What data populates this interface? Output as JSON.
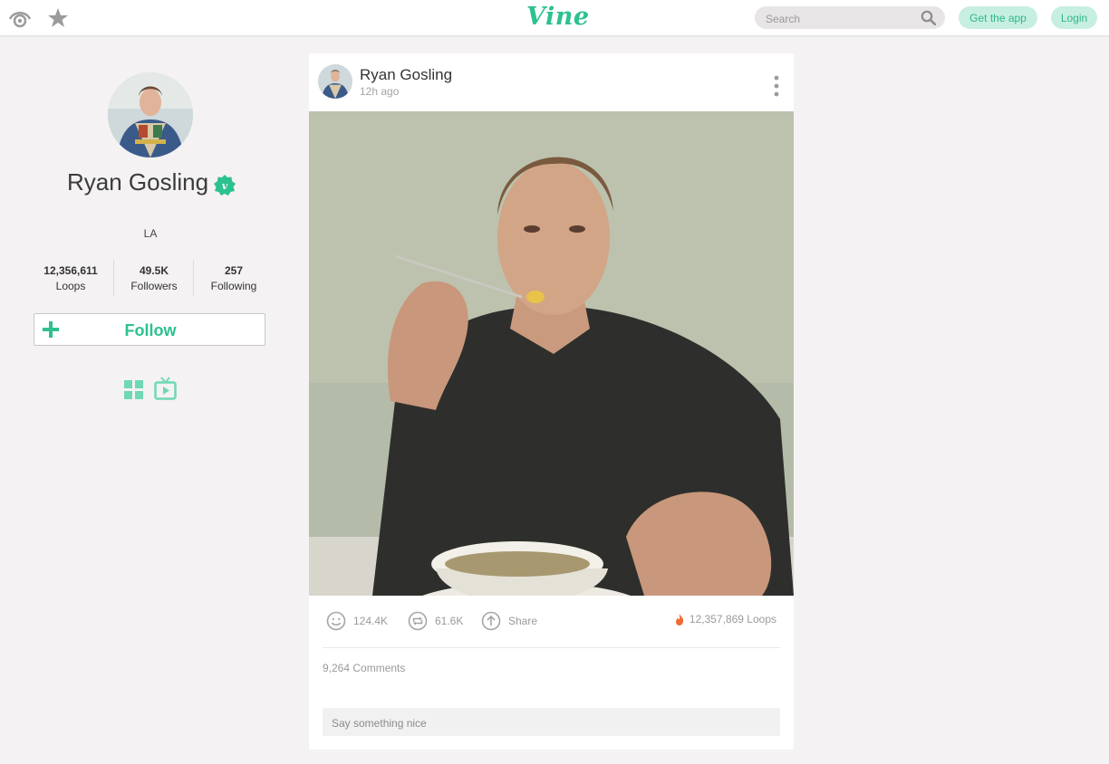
{
  "colors": {
    "brand": "#2cc190",
    "pill_bg": "#c7efe1",
    "page_bg": "#f4f2f3",
    "loop_flame": "#f06a35"
  },
  "header": {
    "logo_text": "Vine",
    "search_placeholder": "Search",
    "get_app_label": "Get the app",
    "login_label": "Login",
    "icons": [
      "eye-icon",
      "star-icon",
      "search-icon"
    ]
  },
  "profile": {
    "name": "Ryan Gosling",
    "location": "LA",
    "stats": [
      {
        "value": "12,356,611",
        "label": "Loops"
      },
      {
        "value": "49.5K",
        "label": "Followers"
      },
      {
        "value": "257",
        "label": "Following"
      }
    ],
    "follow_label": "Follow",
    "view_icons": [
      "grid-view-icon",
      "tv-view-icon"
    ]
  },
  "post": {
    "author": "Ryan Gosling",
    "time": "12h ago",
    "likes": "124.4K",
    "revines": "61.6K",
    "share_label": "Share",
    "loops": "12,357,869 Loops",
    "comments": "9,264 Comments",
    "comment_placeholder": "Say something nice"
  }
}
